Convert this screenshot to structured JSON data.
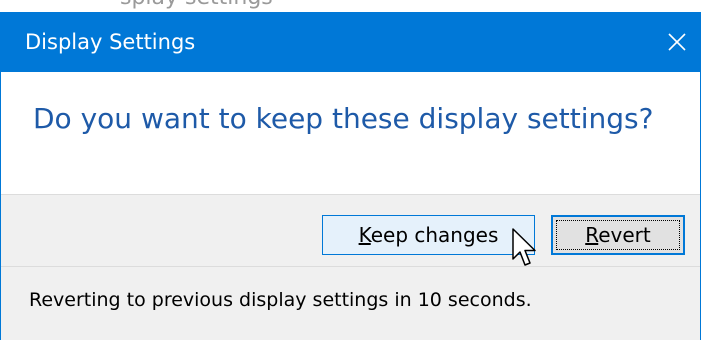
{
  "background_fragment": {
    "text": "splay settings"
  },
  "dialog": {
    "title": "Display Settings",
    "close_icon": "close-icon",
    "message": "Do you want to keep these display settings?",
    "buttons": {
      "keep": {
        "mnemonic": "K",
        "rest": "eep changes",
        "label": "Keep changes"
      },
      "revert": {
        "mnemonic": "R",
        "rest": "evert",
        "label": "Revert"
      }
    },
    "status": "Reverting to previous display settings in 10 seconds."
  },
  "cursor_icon": "arrow-pointer-icon",
  "colors": {
    "accent": "#0078d7",
    "message_text": "#1e5aa8",
    "footer_bg": "#f0f0f0",
    "hover_button_bg": "#e5f1fb",
    "button_bg": "#e1e1e1"
  }
}
